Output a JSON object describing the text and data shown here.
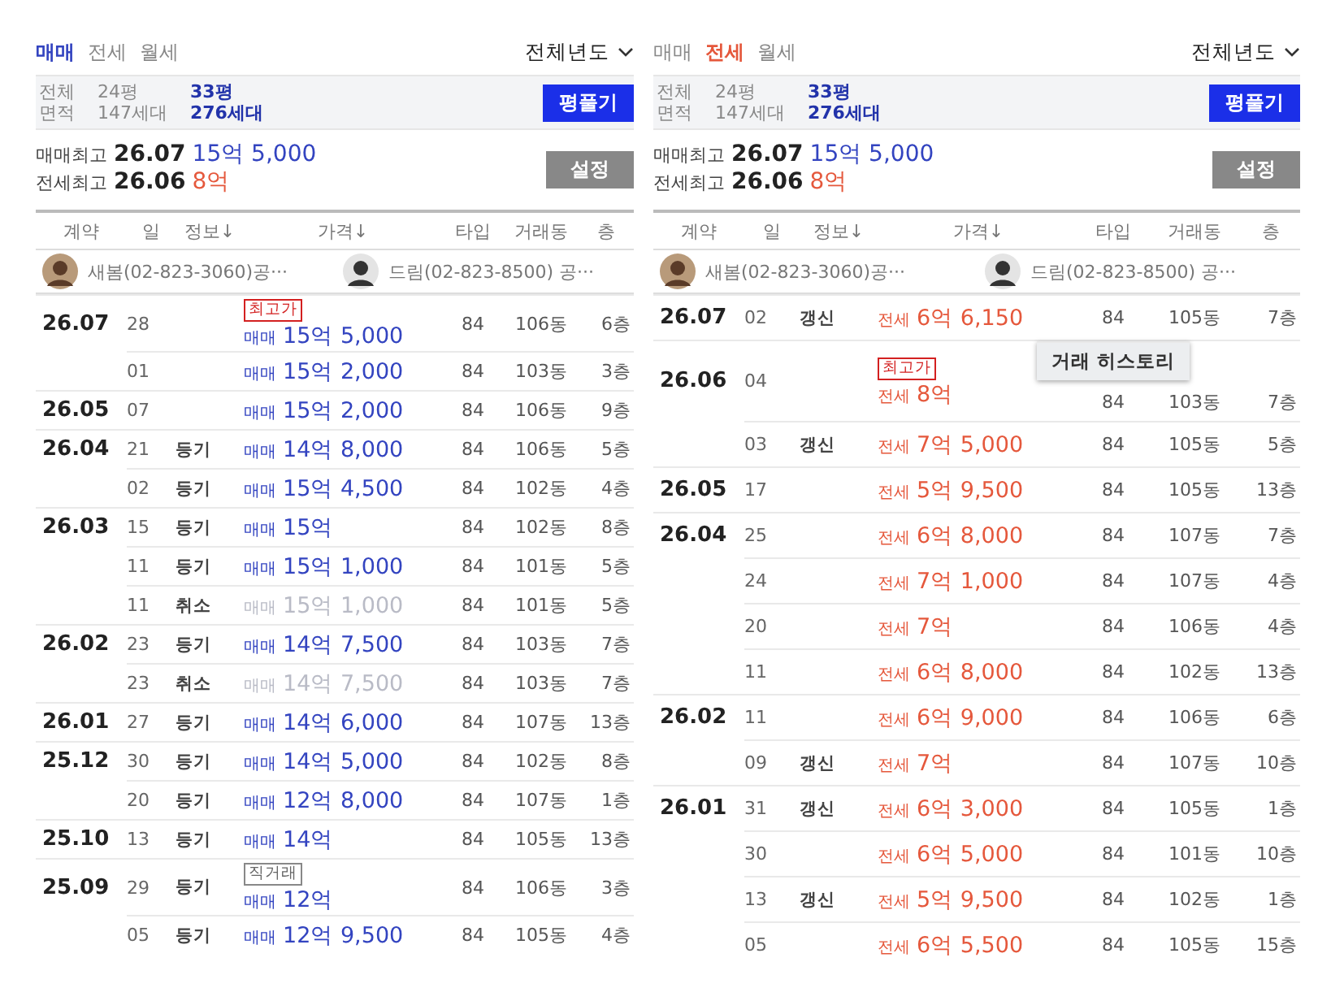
{
  "panels": [
    {
      "tabs": [
        {
          "label": "매매",
          "selected": true
        },
        {
          "label": "전세",
          "selected": false
        },
        {
          "label": "월세",
          "selected": false
        }
      ],
      "year_filter": "전체년도",
      "area_label": [
        "전체",
        "면적"
      ],
      "areas": [
        {
          "size": "24평",
          "households": "147세대",
          "selected": false
        },
        {
          "size": "33평",
          "households": "276세대",
          "selected": true
        }
      ],
      "area_button": "평풀기",
      "highs": [
        {
          "label": "매매최고",
          "date": "26.07",
          "price": "15억 5,000",
          "kind": "sale"
        },
        {
          "label": "전세최고",
          "date": "26.06",
          "price": "8억",
          "kind": "jeonse"
        }
      ],
      "settings_button": "설정",
      "columns": [
        "계약",
        "일",
        "정보↓",
        "가격↓",
        "타입",
        "거래동",
        "층"
      ],
      "agents": [
        {
          "text": "새봄(02-823-3060)공···"
        },
        {
          "text": "드림(02-823-8500) 공···"
        }
      ],
      "rows": [
        {
          "month": "26.07",
          "day": "28",
          "info": "",
          "badge": {
            "text": "최고가",
            "kind": "highest"
          },
          "kind": "sale",
          "deal": "매매",
          "price": "15억 5,000",
          "cancelled": false,
          "type": "84",
          "dong": "106동",
          "floor": "6층"
        },
        {
          "month": "",
          "day": "01",
          "info": "",
          "kind": "sale",
          "deal": "매매",
          "price": "15억 2,000",
          "cancelled": false,
          "type": "84",
          "dong": "103동",
          "floor": "3층"
        },
        {
          "month": "26.05",
          "day": "07",
          "info": "",
          "kind": "sale",
          "deal": "매매",
          "price": "15억 2,000",
          "cancelled": false,
          "type": "84",
          "dong": "106동",
          "floor": "9층"
        },
        {
          "month": "26.04",
          "day": "21",
          "info": "등기",
          "kind": "sale",
          "deal": "매매",
          "price": "14억 8,000",
          "cancelled": false,
          "type": "84",
          "dong": "106동",
          "floor": "5층"
        },
        {
          "month": "",
          "day": "02",
          "info": "등기",
          "kind": "sale",
          "deal": "매매",
          "price": "15억 4,500",
          "cancelled": false,
          "type": "84",
          "dong": "102동",
          "floor": "4층"
        },
        {
          "month": "26.03",
          "day": "15",
          "info": "등기",
          "kind": "sale",
          "deal": "매매",
          "price": "15억",
          "cancelled": false,
          "type": "84",
          "dong": "102동",
          "floor": "8층"
        },
        {
          "month": "",
          "day": "11",
          "info": "등기",
          "kind": "sale",
          "deal": "매매",
          "price": "15억 1,000",
          "cancelled": false,
          "type": "84",
          "dong": "101동",
          "floor": "5층"
        },
        {
          "month": "",
          "day": "11",
          "info": "취소",
          "kind": "sale",
          "deal": "매매",
          "price": "15억 1,000",
          "cancelled": true,
          "type": "84",
          "dong": "101동",
          "floor": "5층"
        },
        {
          "month": "26.02",
          "day": "23",
          "info": "등기",
          "kind": "sale",
          "deal": "매매",
          "price": "14억 7,500",
          "cancelled": false,
          "type": "84",
          "dong": "103동",
          "floor": "7층"
        },
        {
          "month": "",
          "day": "23",
          "info": "취소",
          "kind": "sale",
          "deal": "매매",
          "price": "14억 7,500",
          "cancelled": true,
          "type": "84",
          "dong": "103동",
          "floor": "7층"
        },
        {
          "month": "26.01",
          "day": "27",
          "info": "등기",
          "kind": "sale",
          "deal": "매매",
          "price": "14억 6,000",
          "cancelled": false,
          "type": "84",
          "dong": "107동",
          "floor": "13층"
        },
        {
          "month": "25.12",
          "day": "30",
          "info": "등기",
          "kind": "sale",
          "deal": "매매",
          "price": "14억 5,000",
          "cancelled": false,
          "type": "84",
          "dong": "102동",
          "floor": "8층"
        },
        {
          "month": "",
          "day": "20",
          "info": "등기",
          "kind": "sale",
          "deal": "매매",
          "price": "12억 8,000",
          "cancelled": false,
          "type": "84",
          "dong": "107동",
          "floor": "1층"
        },
        {
          "month": "25.10",
          "day": "13",
          "info": "등기",
          "kind": "sale",
          "deal": "매매",
          "price": "14억",
          "cancelled": false,
          "type": "84",
          "dong": "105동",
          "floor": "13층"
        },
        {
          "month": "25.09",
          "day": "29",
          "info": "등기",
          "badge": {
            "text": "직거래",
            "kind": "direct"
          },
          "kind": "sale",
          "deal": "매매",
          "price": "12억",
          "cancelled": false,
          "type": "84",
          "dong": "106동",
          "floor": "3층"
        },
        {
          "month": "",
          "day": "05",
          "info": "등기",
          "kind": "sale",
          "deal": "매매",
          "price": "12억 9,500",
          "cancelled": false,
          "type": "84",
          "dong": "105동",
          "floor": "4층"
        }
      ]
    },
    {
      "tabs": [
        {
          "label": "매매",
          "selected": false
        },
        {
          "label": "전세",
          "selected": true
        },
        {
          "label": "월세",
          "selected": false
        }
      ],
      "year_filter": "전체년도",
      "area_label": [
        "전체",
        "면적"
      ],
      "areas": [
        {
          "size": "24평",
          "households": "147세대",
          "selected": false
        },
        {
          "size": "33평",
          "households": "276세대",
          "selected": true
        }
      ],
      "area_button": "평풀기",
      "highs": [
        {
          "label": "매매최고",
          "date": "26.07",
          "price": "15억 5,000",
          "kind": "sale"
        },
        {
          "label": "전세최고",
          "date": "26.06",
          "price": "8억",
          "kind": "jeonse"
        }
      ],
      "settings_button": "설정",
      "columns": [
        "계약",
        "일",
        "정보↓",
        "가격↓",
        "타입",
        "거래동",
        "층"
      ],
      "agents": [
        {
          "text": "새봄(02-823-3060)공···"
        },
        {
          "text": "드림(02-823-8500) 공···"
        }
      ],
      "rows": [
        {
          "month": "26.07",
          "day": "02",
          "info": "갱신",
          "kind": "jeonse",
          "deal": "전세",
          "price": "6억 6,150",
          "cancelled": false,
          "type": "84",
          "dong": "105동",
          "floor": "7층"
        },
        {
          "month": "26.06",
          "day": "04",
          "info": "",
          "tooltip": "거래 히스토리",
          "badge": {
            "text": "최고가",
            "kind": "highest"
          },
          "kind": "jeonse",
          "deal": "전세",
          "price": "8억",
          "cancelled": false,
          "type": "84",
          "dong": "103동",
          "floor": "7층"
        },
        {
          "month": "",
          "day": "03",
          "info": "갱신",
          "kind": "jeonse",
          "deal": "전세",
          "price": "7억 5,000",
          "cancelled": false,
          "type": "84",
          "dong": "105동",
          "floor": "5층"
        },
        {
          "month": "26.05",
          "day": "17",
          "info": "",
          "kind": "jeonse",
          "deal": "전세",
          "price": "5억 9,500",
          "cancelled": false,
          "type": "84",
          "dong": "105동",
          "floor": "13층"
        },
        {
          "month": "26.04",
          "day": "25",
          "info": "",
          "kind": "jeonse",
          "deal": "전세",
          "price": "6억 8,000",
          "cancelled": false,
          "type": "84",
          "dong": "107동",
          "floor": "7층"
        },
        {
          "month": "",
          "day": "24",
          "info": "",
          "kind": "jeonse",
          "deal": "전세",
          "price": "7억 1,000",
          "cancelled": false,
          "type": "84",
          "dong": "107동",
          "floor": "4층"
        },
        {
          "month": "",
          "day": "20",
          "info": "",
          "kind": "jeonse",
          "deal": "전세",
          "price": "7억",
          "cancelled": false,
          "type": "84",
          "dong": "106동",
          "floor": "4층"
        },
        {
          "month": "",
          "day": "11",
          "info": "",
          "kind": "jeonse",
          "deal": "전세",
          "price": "6억 8,000",
          "cancelled": false,
          "type": "84",
          "dong": "102동",
          "floor": "13층"
        },
        {
          "month": "26.02",
          "day": "11",
          "info": "",
          "kind": "jeonse",
          "deal": "전세",
          "price": "6억 9,000",
          "cancelled": false,
          "type": "84",
          "dong": "106동",
          "floor": "6층"
        },
        {
          "month": "",
          "day": "09",
          "info": "갱신",
          "kind": "jeonse",
          "deal": "전세",
          "price": "7억",
          "cancelled": false,
          "type": "84",
          "dong": "107동",
          "floor": "10층"
        },
        {
          "month": "26.01",
          "day": "31",
          "info": "갱신",
          "kind": "jeonse",
          "deal": "전세",
          "price": "6억 3,000",
          "cancelled": false,
          "type": "84",
          "dong": "105동",
          "floor": "1층"
        },
        {
          "month": "",
          "day": "30",
          "info": "",
          "kind": "jeonse",
          "deal": "전세",
          "price": "6억 5,000",
          "cancelled": false,
          "type": "84",
          "dong": "101동",
          "floor": "10층"
        },
        {
          "month": "",
          "day": "13",
          "info": "갱신",
          "kind": "jeonse",
          "deal": "전세",
          "price": "5억 9,500",
          "cancelled": false,
          "type": "84",
          "dong": "102동",
          "floor": "1층"
        },
        {
          "month": "",
          "day": "05",
          "info": "",
          "kind": "jeonse",
          "deal": "전세",
          "price": "6억 5,500",
          "cancelled": false,
          "type": "84",
          "dong": "105동",
          "floor": "15층"
        }
      ]
    }
  ]
}
